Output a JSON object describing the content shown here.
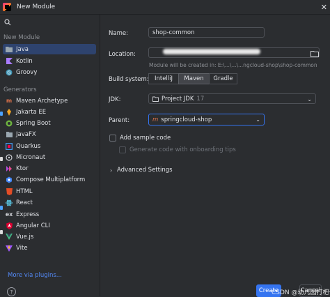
{
  "window": {
    "title": "New Module"
  },
  "sidebar": {
    "section_new_module": "New Module",
    "new_module_items": [
      {
        "label": "Java",
        "icon": "java-folder-icon",
        "selected": true
      },
      {
        "label": "Kotlin",
        "icon": "kotlin-icon",
        "selected": false
      },
      {
        "label": "Groovy",
        "icon": "groovy-icon",
        "selected": false
      }
    ],
    "section_generators": "Generators",
    "generators": [
      {
        "label": "Maven Archetype",
        "icon": "maven-icon"
      },
      {
        "label": "Jakarta EE",
        "icon": "jakarta-icon"
      },
      {
        "label": "Spring Boot",
        "icon": "spring-icon"
      },
      {
        "label": "JavaFX",
        "icon": "javafx-icon"
      },
      {
        "label": "Quarkus",
        "icon": "quarkus-icon"
      },
      {
        "label": "Micronaut",
        "icon": "micronaut-icon"
      },
      {
        "label": "Ktor",
        "icon": "ktor-icon"
      },
      {
        "label": "Compose Multiplatform",
        "icon": "compose-icon"
      },
      {
        "label": "HTML",
        "icon": "html-icon"
      },
      {
        "label": "React",
        "icon": "react-icon"
      },
      {
        "label": "Express",
        "icon": "express-icon"
      },
      {
        "label": "Angular CLI",
        "icon": "angular-icon"
      },
      {
        "label": "Vue.js",
        "icon": "vue-icon"
      },
      {
        "label": "Vite",
        "icon": "vite-icon"
      }
    ],
    "more_plugins": "More via plugins...",
    "help": "?"
  },
  "form": {
    "name_label": "Name:",
    "name_value": "shop-common",
    "location_label": "Location:",
    "location_hint": "Module will be created in: E:\\...\\...\\...ngcloud-shop\\shop-common",
    "build_system_label": "Build system:",
    "build_systems": [
      "IntelliJ",
      "Maven",
      "Gradle"
    ],
    "build_system_selected": "Maven",
    "jdk_label": "JDK:",
    "jdk_value": "Project JDK",
    "jdk_version": "17",
    "parent_label": "Parent:",
    "parent_value": "springcloud-shop",
    "add_sample_code": "Add sample code",
    "generate_onboarding": "Generate code with onboarding tips",
    "advanced_settings": "Advanced Settings"
  },
  "footer": {
    "create": "Create",
    "cancel": "Cancel",
    "watermark": "CSDN @幼儿园打杷子\\"
  },
  "colors": {
    "accent": "#3574f0",
    "selection": "#2e436e",
    "link": "#548af7",
    "background": "#2b2d30"
  }
}
